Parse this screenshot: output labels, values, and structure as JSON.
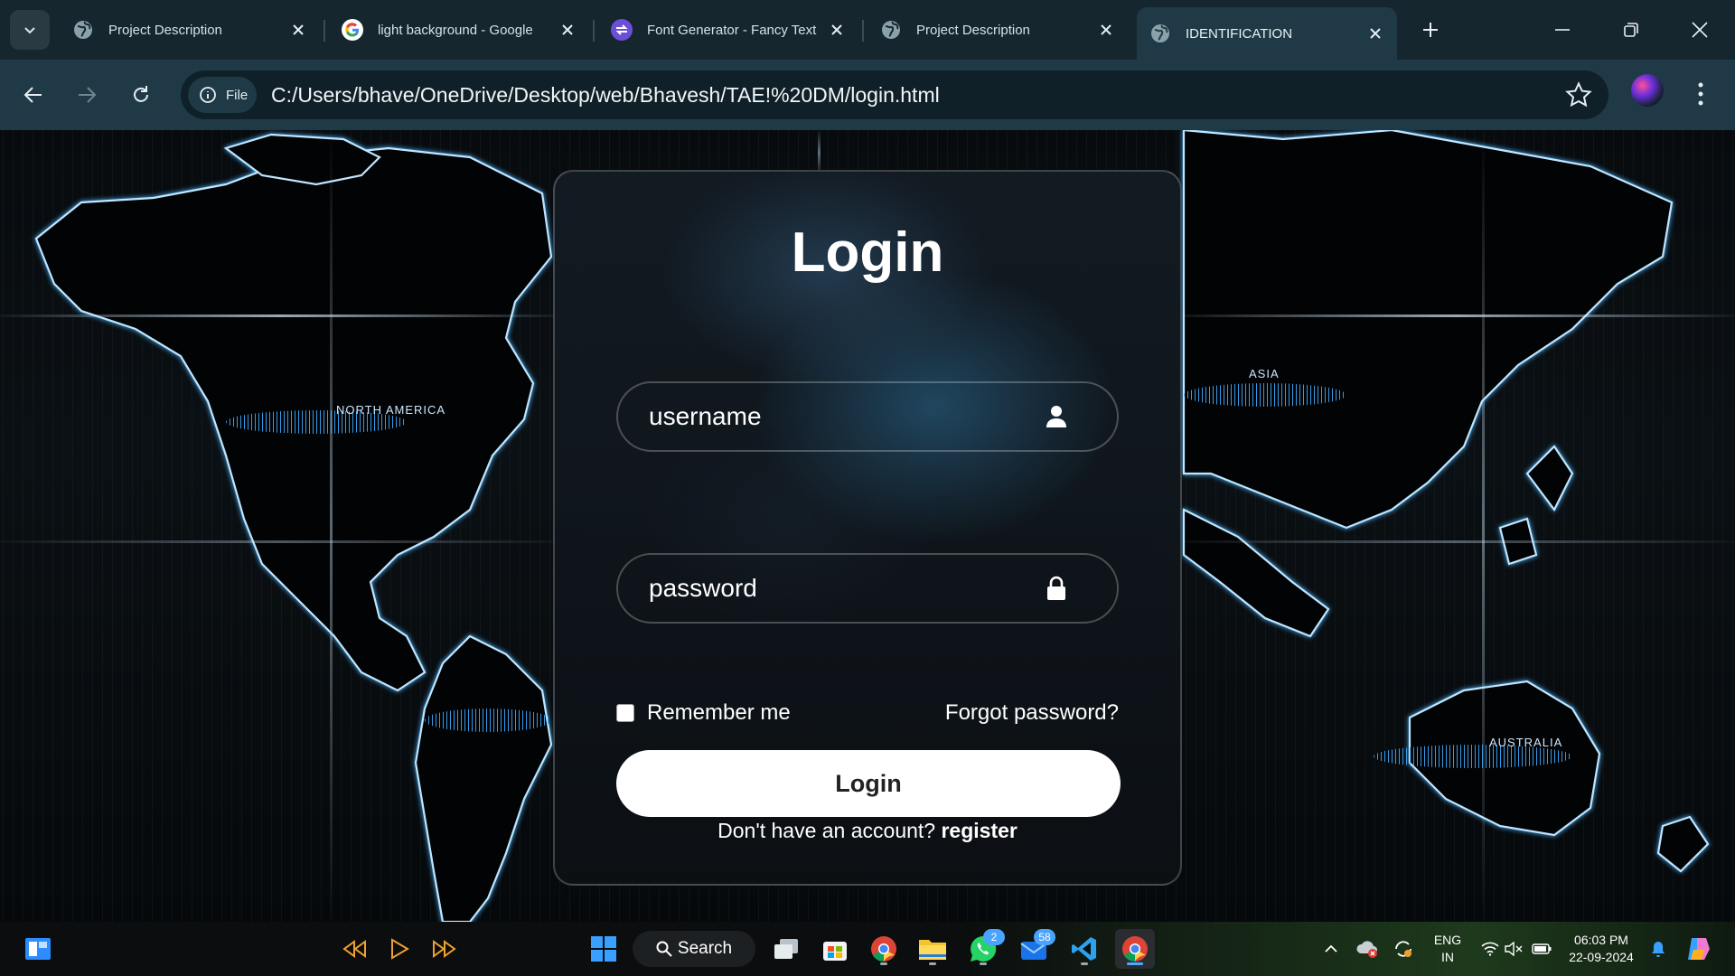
{
  "browser": {
    "tabs": [
      {
        "title": "Project Description",
        "icon": "globe-icon",
        "active": false
      },
      {
        "title": "light background - Google",
        "icon": "google-icon",
        "active": false
      },
      {
        "title": "Font Generator - Fancy Text",
        "icon": "font-generator-icon",
        "active": false
      },
      {
        "title": "Project Description",
        "icon": "globe-icon",
        "active": false
      },
      {
        "title": "IDENTIFICATION",
        "icon": "globe-icon",
        "active": true
      }
    ],
    "site_chip": "File",
    "url": "C:/Users/bhave/OneDrive/Desktop/web/Bhavesh/TAE!%20DM/login.html"
  },
  "background": {
    "regions": [
      "NORTH AMERICA",
      "ASIA",
      "AUSTRALIA"
    ]
  },
  "login": {
    "title": "Login",
    "username_placeholder": "username",
    "password_placeholder": "password",
    "remember_label": "Remember me",
    "forgot_label": "Forgot password?",
    "button_label": "Login",
    "no_account_text": "Don't have an account?",
    "register_label": "register"
  },
  "taskbar": {
    "search_label": "Search",
    "whatsapp_badge": "2",
    "mail_badge": "58",
    "language": "ENG",
    "region": "IN",
    "time": "06:03 PM",
    "date": "22-09-2024"
  },
  "colors": {
    "tabbar": "#16262e",
    "toolbar": "#1f3a46",
    "accent_blue": "#4aa3ff"
  }
}
